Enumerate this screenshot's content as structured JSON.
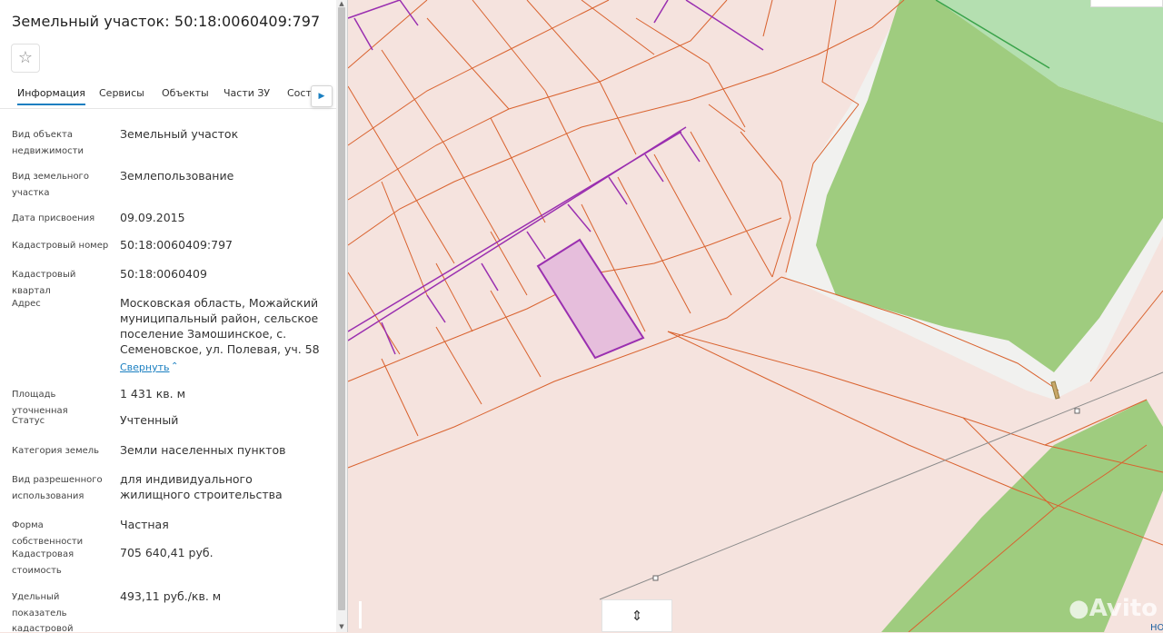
{
  "panel": {
    "title": "Земельный участок: 50:18:0060409:797",
    "favorite_icon": "star-outline-icon",
    "tabs": [
      {
        "label": "Информация",
        "active": true
      },
      {
        "label": "Сервисы",
        "active": false
      },
      {
        "label": "Объекты",
        "active": false
      },
      {
        "label": "Части ЗУ",
        "active": false
      },
      {
        "label": "Соста",
        "active": false
      }
    ],
    "tabs_next_icon": "caret-right-icon",
    "fields": [
      {
        "label": "Вид объекта недвижимости",
        "value": "Земельный участок"
      },
      {
        "label": "Вид земельного участка",
        "value": "Землепользование"
      },
      {
        "label": "Дата присвоения",
        "value": "09.09.2015"
      },
      {
        "label": "Кадастровый номер",
        "value": "50:18:0060409:797"
      },
      {
        "label": "Кадастровый квартал",
        "value": "50:18:0060409"
      },
      {
        "label": "Адрес",
        "value": "Московская область, Можайский муниципальный район, сельское поселение Замошинское, с. Семеновское, ул. Полевая, уч. 58"
      },
      {
        "label": "Площадь уточненная",
        "value": "1 431 кв. м"
      },
      {
        "label": "Статус",
        "value": "Учтенный"
      },
      {
        "label": "Категория земель",
        "value": "Земли населенных пунктов"
      },
      {
        "label": "Вид разрешенного использования",
        "value": "для индивидуального жилищного строительства"
      },
      {
        "label": "Форма собственности",
        "value": "Частная"
      },
      {
        "label": "Кадастровая стоимость",
        "value": "705 640,41 руб."
      },
      {
        "label": "Удельный показатель кадастровой стоимости",
        "value": "493,11 руб./кв. м"
      }
    ],
    "collapse_link": "Свернуть",
    "collapse_icon": "chevron-up-icon"
  },
  "map": {
    "background_color": "#f5e3de",
    "parcel_line_color": "#d9622e",
    "selected_parcel_fill": "#e6bedc",
    "selected_parcel_stroke": "#9a2fb0",
    "forest_color": "#9fcc7f",
    "light_green_color": "#a8d9a6",
    "zoom_toggle_icon": "chevron-up-down-icon",
    "corner_text": "НО"
  },
  "watermark": {
    "text": "Avito",
    "icon": "avito-logo-icon"
  }
}
